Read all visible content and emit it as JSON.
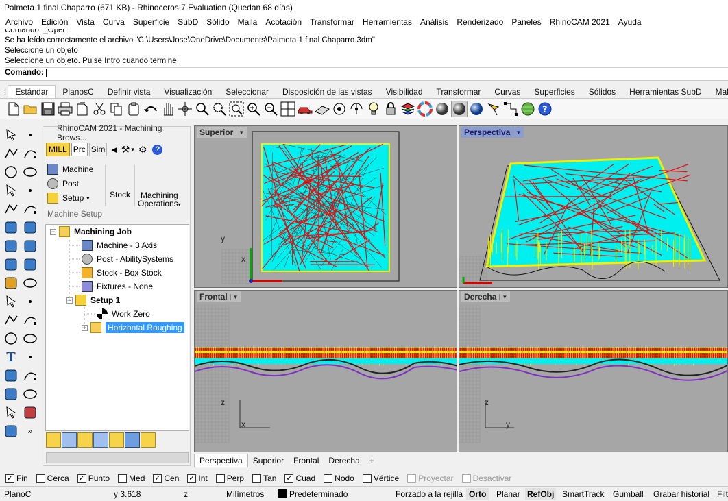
{
  "window": {
    "title": "Palmeta 1 final Chaparro (671 KB) - Rhinoceros 7 Evaluation (Quedan 68 días)"
  },
  "menu": [
    "Archivo",
    "Edición",
    "Vista",
    "Curva",
    "Superficie",
    "SubD",
    "Sólido",
    "Malla",
    "Acotación",
    "Transformar",
    "Herramientas",
    "Análisis",
    "Renderizado",
    "Paneles",
    "RhinoCAM 2021",
    "Ayuda"
  ],
  "command_history": {
    "lines": [
      "Comando: _Open",
      "Se ha leído correctamente el archivo \"C:\\Users\\Jose\\OneDrive\\Documents\\Palmeta 1 final Chaparro.3dm\"",
      "Seleccione un objeto",
      "Seleccione un objeto. Pulse Intro cuando termine"
    ],
    "prompt": "Comando:"
  },
  "toolbar_tabs": [
    "Estándar",
    "PlanosC",
    "Definir vista",
    "Visualización",
    "Seleccionar",
    "Disposición de las vistas",
    "Visibilidad",
    "Transformar",
    "Curvas",
    "Superficies",
    "Sólidos",
    "Herramientas SubD",
    "Mallas"
  ],
  "toolbar_icons": [
    "new-icon",
    "open-icon",
    "save-icon",
    "print-icon",
    "import-icon",
    "cut-icon",
    "copy-icon",
    "paste-icon",
    "undo-icon",
    "pan-icon",
    "rotate-icon",
    "zoom-icon",
    "zoom-window-icon",
    "zoom-extents-icon",
    "zoom-selected-icon",
    "four-viewports-icon",
    "car-icon",
    "grid-icon",
    "cplane-icon",
    "light-icon",
    "lock-icon",
    "layers-icon",
    "color-icon",
    "shaded-sphere-icon",
    "rendered-sphere-icon",
    "blue-sphere-icon",
    "light-source-icon",
    "ortho-snap-icon",
    "globe-icon",
    "help-icon"
  ],
  "rhinocam_panel": {
    "title": "RhinoCAM 2021 - Machining Brows...",
    "tabs": {
      "mill": "MILL",
      "prg": "Prc",
      "sim": "Sim"
    },
    "ribbon": {
      "machine": "Machine",
      "post": "Post",
      "setup": "Setup",
      "stock": "Stock",
      "machining": "Machining",
      "operations": "Operations",
      "group_label": "Machine Setup"
    },
    "tree": {
      "root": "Machining Job",
      "machine": "Machine - 3 Axis",
      "post": "Post - AbilitySystems",
      "stock": "Stock - Box Stock",
      "fixtures": "Fixtures - None",
      "setup": "Setup 1",
      "work_zero": "Work Zero",
      "operation": "Horizontal Roughing"
    }
  },
  "viewports": {
    "top": "Superior",
    "perspective": "Perspectiva",
    "front": "Frontal",
    "right": "Derecha",
    "axis_x": "x",
    "axis_y": "y",
    "axis_z": "z"
  },
  "viewport_tabs": [
    "Perspectiva",
    "Superior",
    "Frontal",
    "Derecha"
  ],
  "viewport_tabs_add": "+",
  "osnaps": [
    {
      "label": "Fin",
      "checked": true,
      "enabled": true
    },
    {
      "label": "Cerca",
      "checked": false,
      "enabled": true
    },
    {
      "label": "Punto",
      "checked": true,
      "enabled": true
    },
    {
      "label": "Med",
      "checked": false,
      "enabled": true
    },
    {
      "label": "Cen",
      "checked": true,
      "enabled": true
    },
    {
      "label": "Int",
      "checked": true,
      "enabled": true
    },
    {
      "label": "Perp",
      "checked": false,
      "enabled": true
    },
    {
      "label": "Tan",
      "checked": false,
      "enabled": true
    },
    {
      "label": "Cuad",
      "checked": true,
      "enabled": true
    },
    {
      "label": "Nodo",
      "checked": false,
      "enabled": true
    },
    {
      "label": "Vértice",
      "checked": false,
      "enabled": true
    },
    {
      "label": "Proyectar",
      "checked": false,
      "enabled": false
    },
    {
      "label": "Desactivar",
      "checked": false,
      "enabled": false
    }
  ],
  "status": {
    "cplane": "PlanoC",
    "y": "y 3.618",
    "z": "z",
    "units": "Milímetros",
    "layer": "Predeterminado",
    "grid_snap": "Forzado a la rejilla",
    "ortho": "Orto",
    "planar": "Planar",
    "osnap": "RefObj",
    "smarttrack": "SmartTrack",
    "gumball": "Gumball",
    "history": "Grabar historial",
    "filter": "Filt"
  },
  "colors": {
    "toolpath_cyan": "#00f0f0",
    "toolpath_red": "#e01010",
    "toolpath_yellow": "#f0f000",
    "viewport_bg": "#a6a6a6",
    "active_viewport": "#8c9ecf",
    "selected_item": "#3399ff"
  }
}
